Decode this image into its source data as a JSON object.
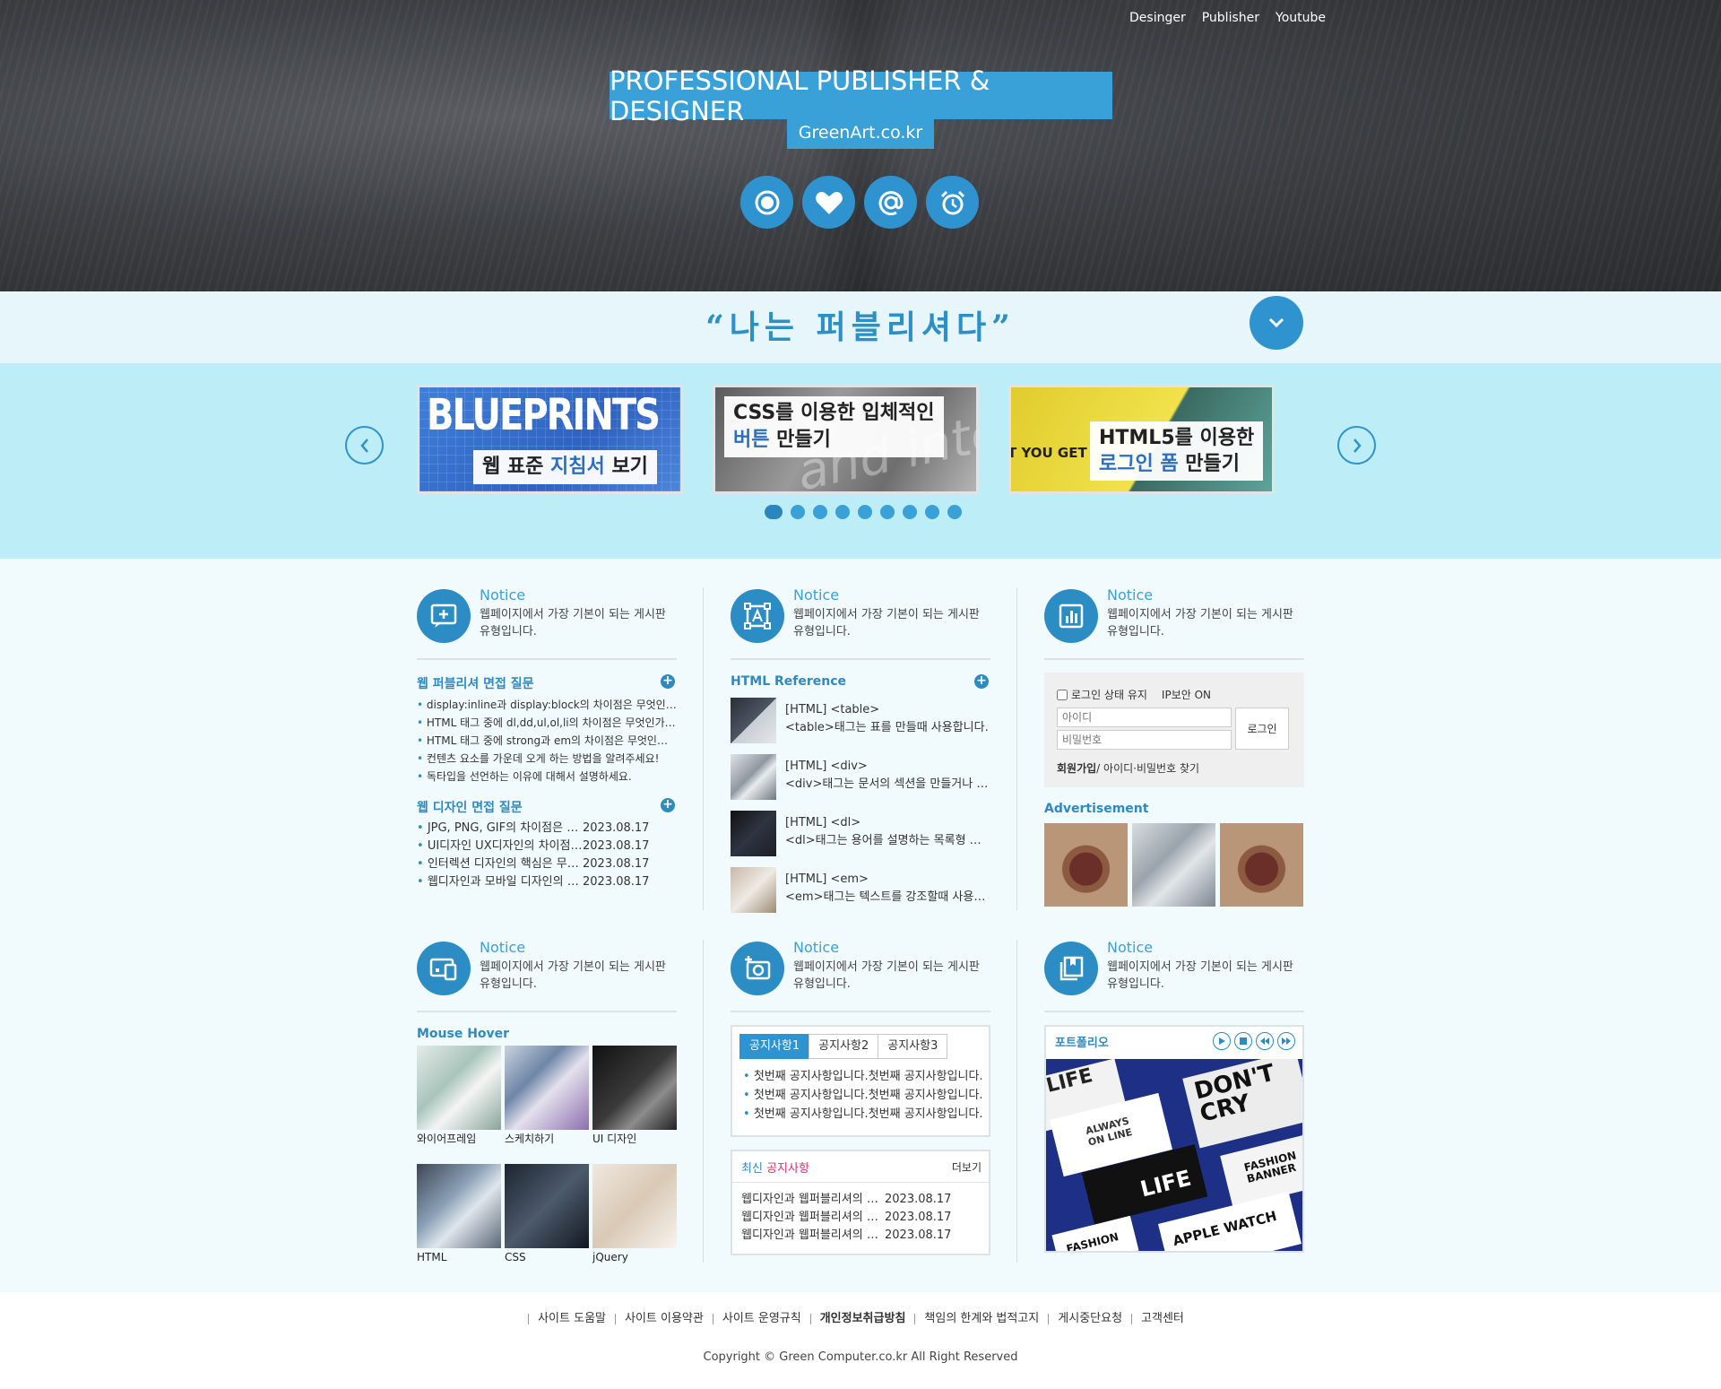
{
  "topnav": {
    "items": [
      "Desinger",
      "Publisher",
      "Youtube"
    ]
  },
  "hero": {
    "title": "PROFESSIONAL PUBLISHER & DESIGNER",
    "subtitle": "GreenArt.co.kr",
    "icons": [
      "target-icon",
      "heart-icon",
      "at-icon",
      "alarm-icon"
    ]
  },
  "slogan": {
    "text": "“나는 퍼블리셔다”"
  },
  "slider": {
    "slides": [
      {
        "bg_text": "BLUEPRINTS",
        "caption_pre": "웹 표준 ",
        "caption_hl": "지침서",
        "caption_post": " 보기"
      },
      {
        "bg_text": "and inte",
        "caption_line1": "CSS를 이용한 입체적인",
        "caption_hl": "버튼",
        "caption_post": " 만들기"
      },
      {
        "bg_text": "T YOU GET",
        "caption_line1": "HTML5를 이용한",
        "caption_hl": "로그인 폼",
        "caption_post": " 만들기"
      }
    ],
    "dots": 9,
    "active_dot": 0
  },
  "notice": {
    "title": "Notice",
    "desc": "웹페이지에서 가장 기본이 되는 게시판 유형입니다."
  },
  "col1": {
    "sect1_title": "웹 퍼블리셔 면접 질문",
    "sect1_items": [
      "display:inline과 display:block의 차이점은 무엇인가요?",
      "HTML 태그 중에 dl,dd,ul,ol,li의 차이점은 무엇인가요?",
      "HTML 태그 중에 strong과 em의 차이점은 무엇인가요?",
      "컨텐츠 요소를 가운데 오게 하는 방법을 알려주세요!",
      "독타입을 선언하는 이유에 대해서 설명하세요."
    ],
    "sect2_title": "웹 디자인 면접 질문",
    "sect2_items": [
      {
        "title": "JPG, PNG, GIF의 차이점은 무엇인가요?",
        "date": "2023.08.17"
      },
      {
        "title": "UI디자인 UX디자인의 차이점은 무엇인가요?",
        "date": "2023.08.17"
      },
      {
        "title": "인터렉션 디자인의 핵심은 무엇인가요?",
        "date": "2023.08.17"
      },
      {
        "title": "웹디자인과 모바일 디자인의 차이점은?",
        "date": "2023.08.17"
      }
    ]
  },
  "col2": {
    "ref_title": "HTML Reference",
    "refs": [
      {
        "tag": "[HTML] <table>",
        "desc": "<table>태그는 표를 만들때 사용합니다."
      },
      {
        "tag": "[HTML] <div>",
        "desc": "<div>태그는 문서의 섹션을 만들거나 그룹화할 때 사용합니다."
      },
      {
        "tag": "[HTML] <dl>",
        "desc": "<dl>태그는 용어를 설명하는 목록형 태그입니다."
      },
      {
        "tag": "[HTML] <em>",
        "desc": "<em>태그는 텍스트를 강조할때 사용합니다."
      }
    ]
  },
  "col3": {
    "keep_login": "로그인 상태 유지",
    "ip_secure": "IP보안 ON",
    "id_placeholder": "아이디",
    "pw_placeholder": "비밀번호",
    "login_btn": "로그인",
    "join": "회원가입",
    "find": "/ 아이디·비밀번호 찾기",
    "ad_title": "Advertisement"
  },
  "col4": {
    "title": "Mouse Hover",
    "items": [
      "와이어프레임",
      "스케치하기",
      "UI 디자인",
      "HTML",
      "CSS",
      "jQuery"
    ]
  },
  "col5": {
    "tabs": [
      "공지사항1",
      "공지사항2",
      "공지사항3"
    ],
    "tab_items": [
      "첫번째 공지사항입니다.첫번째 공지사항입니다.",
      "첫번째 공지사항입니다.첫번째 공지사항입니다.",
      "첫번째 공지사항입니다.첫번째 공지사항입니다."
    ],
    "latest_title_pre": "최신",
    "latest_title_post": "공지사항",
    "more": "더보기",
    "latest_items": [
      {
        "title": "웹디자인과 웹퍼블리셔의 차이점",
        "date": "2023.08.17"
      },
      {
        "title": "웹디자인과 웹퍼블리셔의 차이점",
        "date": "2023.08.17"
      },
      {
        "title": "웹디자인과 웹퍼블리셔의 차이점",
        "date": "2023.08.17"
      }
    ]
  },
  "col6": {
    "title": "포트폴리오",
    "controls": [
      "play-icon",
      "stop-icon",
      "prev-icon",
      "next-icon"
    ],
    "poster_texts": [
      "LIFE",
      "DON'T CRY",
      "ALWAYS ON LINE",
      "FASHION BANNER",
      "LIFE",
      "APPLE WATCH",
      "FASHION"
    ]
  },
  "footer": {
    "links": [
      "사이트 도움말",
      "사이트 이용약관",
      "사이트 운영규칙",
      "개인정보취급방침",
      "책임의 한계와 법적고지",
      "게시중단요청",
      "고객센터"
    ],
    "copyright": "Copyright © Green Computer.co.kr All Right Reserved"
  },
  "colors": {
    "primary": "#2f93cf",
    "hero_box": "#3aa0d8",
    "slider_bg": "#bdeef7",
    "slogan_bg": "#e7f6fb",
    "main_bg": "#f1fafd"
  }
}
